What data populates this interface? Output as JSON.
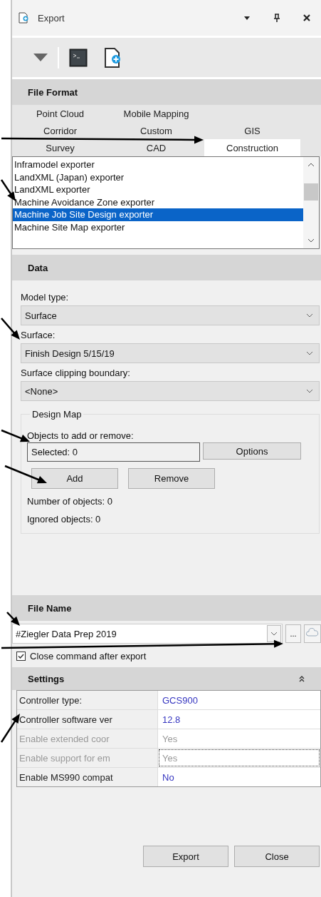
{
  "window": {
    "title": "Export"
  },
  "file_format": {
    "title": "File Format",
    "tab_rows": [
      [
        {
          "label": "Point Cloud",
          "selected": false
        },
        {
          "label": "Mobile Mapping",
          "selected": false
        }
      ],
      [
        {
          "label": "Corridor",
          "selected": false
        },
        {
          "label": "Custom",
          "selected": false
        },
        {
          "label": "GIS",
          "selected": false
        }
      ],
      [
        {
          "label": "Survey",
          "selected": false
        },
        {
          "label": "CAD",
          "selected": false
        },
        {
          "label": "Construction",
          "selected": true
        }
      ]
    ],
    "exporters": [
      {
        "label": "Inframodel exporter",
        "selected": false
      },
      {
        "label": "LandXML (Japan) exporter",
        "selected": false
      },
      {
        "label": "LandXML exporter",
        "selected": false
      },
      {
        "label": "Machine Avoidance Zone exporter",
        "selected": false
      },
      {
        "label": "Machine Job Site Design exporter",
        "selected": true
      },
      {
        "label": "Machine Site Map exporter",
        "selected": false
      }
    ]
  },
  "data": {
    "title": "Data",
    "fields": [
      {
        "label": "Model type:",
        "value": "Surface"
      },
      {
        "label": "Surface:",
        "value": "Finish Design 5/15/19"
      },
      {
        "label": "Surface clipping boundary:",
        "value": "<None>"
      }
    ],
    "design_map": {
      "title": "Design Map",
      "objects_label": "Objects to add or remove:",
      "selection": "Selected: 0",
      "options_button": "Options",
      "add_button": "Add",
      "remove_button": "Remove",
      "number_of_objects": "Number of objects: 0",
      "ignored_objects": "Ignored objects: 0"
    }
  },
  "file_name": {
    "title": "File Name",
    "value": "#Ziegler Data Prep 2019",
    "browse_button": "...",
    "close_after_export": {
      "label": "Close command after export",
      "checked": true
    }
  },
  "settings": {
    "title": "Settings",
    "rows": [
      {
        "name": "Controller type:",
        "value": "GCS900",
        "disabled": false,
        "focused": false
      },
      {
        "name": "Controller software ver",
        "value": "12.8",
        "disabled": false,
        "focused": false
      },
      {
        "name": "Enable extended coor",
        "value": "Yes",
        "disabled": true,
        "focused": false
      },
      {
        "name": "Enable support for em",
        "value": "Yes",
        "disabled": true,
        "focused": true
      },
      {
        "name": "Enable MS990 compat",
        "value": "No",
        "disabled": false,
        "focused": false
      }
    ]
  },
  "buttons": [
    "Export",
    "Close"
  ]
}
